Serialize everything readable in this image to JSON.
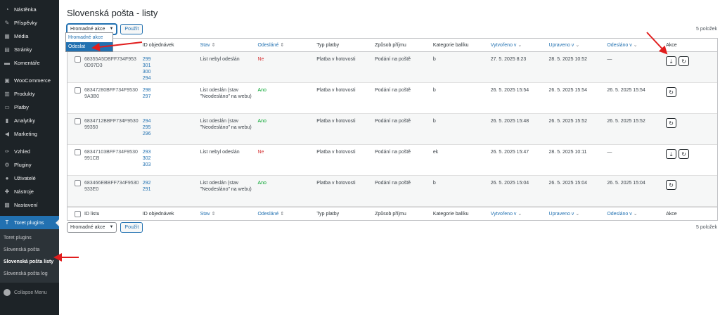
{
  "sidebar": {
    "items": [
      {
        "label": "Nástěnka",
        "icon": "dashboard-icon",
        "glyph": "◔"
      },
      {
        "label": "Příspěvky",
        "icon": "pin-icon",
        "glyph": "✎"
      },
      {
        "label": "Média",
        "icon": "media-icon",
        "glyph": "▦"
      },
      {
        "label": "Stránky",
        "icon": "pages-icon",
        "glyph": "▤"
      },
      {
        "label": "Komentáře",
        "icon": "comments-icon",
        "glyph": "▬"
      },
      {
        "label": "WooCommerce",
        "icon": "woocommerce-icon",
        "glyph": "▣"
      },
      {
        "label": "Produkty",
        "icon": "products-icon",
        "glyph": "▥"
      },
      {
        "label": "Platby",
        "icon": "payments-icon",
        "glyph": "▭"
      },
      {
        "label": "Analytiky",
        "icon": "analytics-icon",
        "glyph": "▮"
      },
      {
        "label": "Marketing",
        "icon": "marketing-icon",
        "glyph": "◀"
      },
      {
        "label": "Vzhled",
        "icon": "appearance-icon",
        "glyph": "✑"
      },
      {
        "label": "Pluginy",
        "icon": "plugins-icon",
        "glyph": "⚙"
      },
      {
        "label": "Uživatelé",
        "icon": "users-icon",
        "glyph": "●"
      },
      {
        "label": "Nástroje",
        "icon": "tools-icon",
        "glyph": "✚"
      },
      {
        "label": "Nastavení",
        "icon": "settings-icon",
        "glyph": "▩"
      },
      {
        "label": "Toret plugins",
        "icon": "toret-icon",
        "glyph": "T"
      }
    ],
    "submenu": [
      "Toret plugins",
      "Slovenská pošta",
      "Slovenská pošta listy",
      "Slovenská pošta log"
    ],
    "collapse": "Collapse Menu"
  },
  "page": {
    "title": "Slovenská pošta - listy",
    "bulk_select": "Hromadné akce",
    "apply": "Použít",
    "count": "5 položek",
    "dropdown": [
      "Hromadné akce",
      "Odeslat"
    ]
  },
  "table": {
    "headers": [
      "ID listu",
      "ID objednávek",
      "Stav",
      "Odesláné",
      "Typ platby",
      "Způsob příjmu",
      "Kategorie balíku",
      "Vytvořeno v",
      "Upraveno v",
      "Odesláno v",
      "Akce"
    ],
    "rows": [
      {
        "id": "68355A5DBFF734F953 0D97D3",
        "orders": [
          "299",
          "301",
          "300",
          "294"
        ],
        "stav": "List nebyl odeslán",
        "odeslane": "Ne",
        "platba": "Platba v hotovosti",
        "prijem": "Podání na poště",
        "kategorie": "b",
        "vytvoreno": "27. 5. 2025 8:23",
        "upraveno": "28. 5. 2025 10:52",
        "odeslano": "—"
      },
      {
        "id": "68347280BFF734F9530 9A3B0",
        "orders": [
          "298",
          "297"
        ],
        "stav": "List odeslán (stav \"Neodesláno\" na webu)",
        "odeslane": "Ano",
        "platba": "Platba v hotovosti",
        "prijem": "Podání na poště",
        "kategorie": "b",
        "vytvoreno": "26. 5. 2025 15:54",
        "upraveno": "26. 5. 2025 15:54",
        "odeslano": "26. 5. 2025 15:54"
      },
      {
        "id": "6834712BBFF734F9530 99350",
        "orders": [
          "294",
          "295",
          "296"
        ],
        "stav": "List odeslán (stav \"Neodesláno\" na webu)",
        "odeslane": "Ano",
        "platba": "Platba v hotovosti",
        "prijem": "Podání na poště",
        "kategorie": "b",
        "vytvoreno": "26. 5. 2025 15:48",
        "upraveno": "26. 5. 2025 15:52",
        "odeslano": "26. 5. 2025 15:52"
      },
      {
        "id": "68347103BFF734F9530 991CB",
        "orders": [
          "293",
          "302",
          "303"
        ],
        "stav": "List nebyl odeslán",
        "odeslane": "Ne",
        "platba": "Platba v hotovosti",
        "prijem": "Podání na poště",
        "kategorie": "ek",
        "vytvoreno": "26. 5. 2025 15:47",
        "upraveno": "28. 5. 2025 10:11",
        "odeslano": "—"
      },
      {
        "id": "683466EBBFF734F9530 933E0",
        "orders": [
          "292",
          "291"
        ],
        "stav": "List odeslán (stav \"Neodesláno\" na webu)",
        "odeslane": "Ano",
        "platba": "Platba v hotovosti",
        "prijem": "Podání na poště",
        "kategorie": "b",
        "vytvoreno": "26. 5. 2025 15:04",
        "upraveno": "26. 5. 2025 15:04",
        "odeslano": "26. 5. 2025 15:04"
      }
    ]
  },
  "colors": {
    "accent": "#2271b1",
    "sidebar": "#1d2327",
    "danger": "#d63638",
    "success": "#00a32a",
    "annotation": "#e11d1d"
  }
}
